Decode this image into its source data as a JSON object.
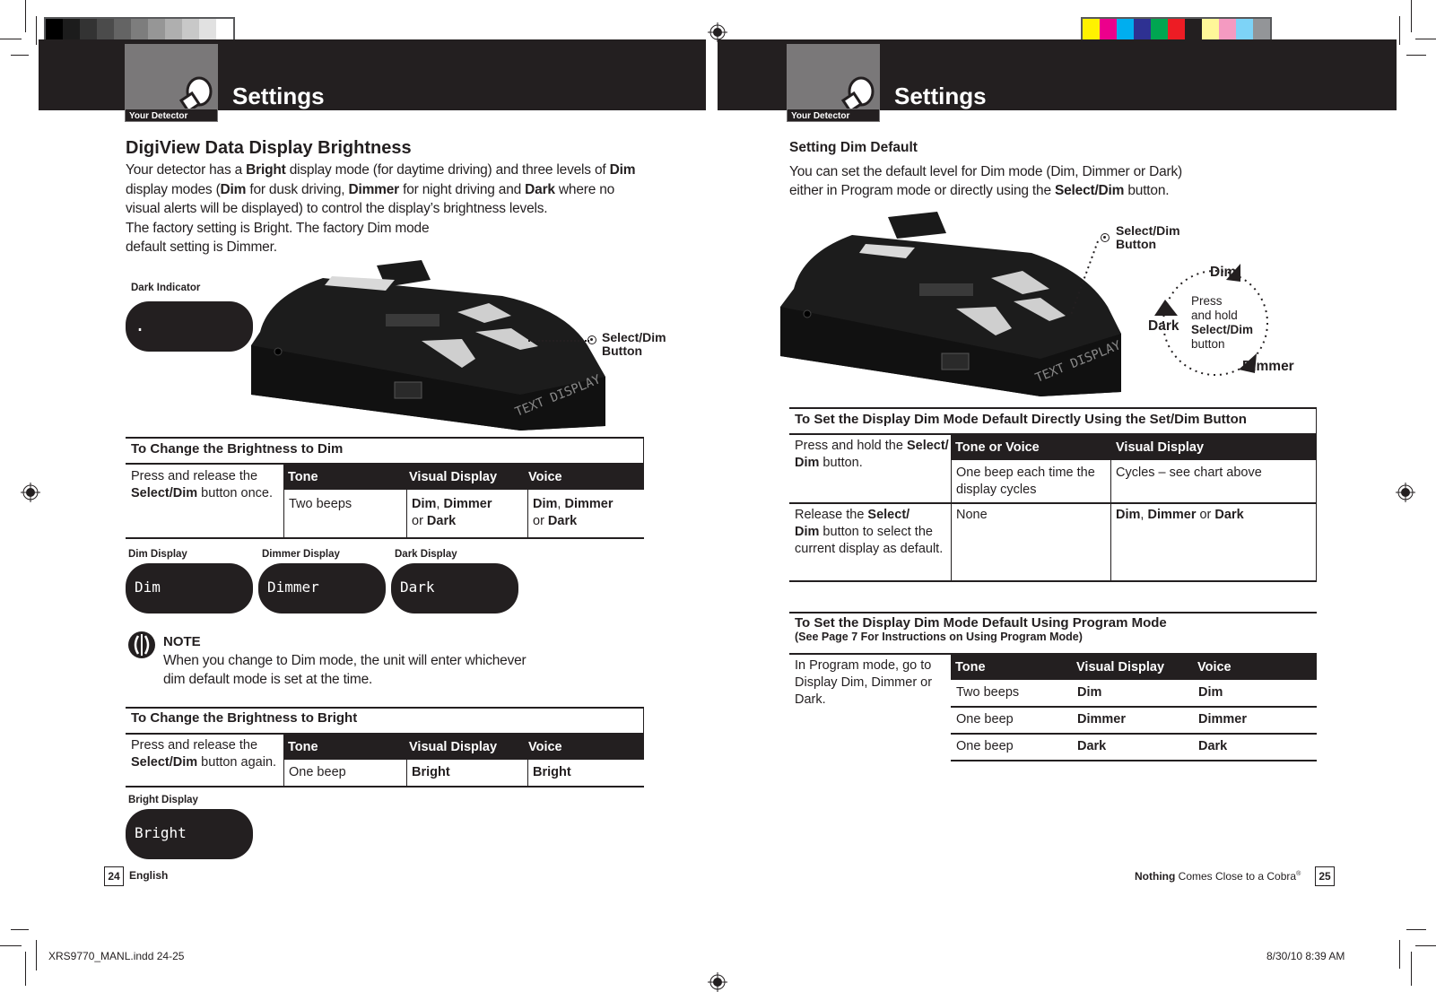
{
  "header": {
    "left": {
      "section_label": "Your Detector",
      "title": "Settings"
    },
    "right": {
      "section_label": "Your Detector",
      "title": "Settings"
    },
    "grayscale_swatches": [
      "#000000",
      "#1c1c1c",
      "#333333",
      "#4b4b4b",
      "#646464",
      "#7d7d7d",
      "#969696",
      "#afafaf",
      "#c8c8c8",
      "#e1e1e1",
      "#ffffff"
    ],
    "color_swatches": [
      "#fff200",
      "#ec008c",
      "#00aeef",
      "#2e3192",
      "#00a651",
      "#ed1c24",
      "#231f20",
      "#fff799",
      "#f49ac1",
      "#7dd3f7",
      "#939598"
    ]
  },
  "left_page": {
    "heading": "DigiView Data Display Brightness",
    "intro": [
      {
        "t": "Your detector has a ",
        "b": false
      },
      {
        "t": "Bright",
        "b": true
      },
      {
        "t": " display mode (for daytime driving) and three levels of ",
        "b": false
      },
      {
        "t": "Dim",
        "b": true
      },
      {
        "t": " display modes (",
        "b": false
      },
      {
        "t": "Dim",
        "b": true
      },
      {
        "t": " for dusk driving, ",
        "b": false
      },
      {
        "t": "Dimmer",
        "b": true
      },
      {
        "t": " for night driving and ",
        "b": false
      },
      {
        "t": "Dark",
        "b": true
      },
      {
        "t": " where no visual alerts will be displayed) to control the display’s brightness levels.",
        "b": false
      }
    ],
    "intro_2": "The factory setting is Bright. The factory Dim mode",
    "intro_3": "default setting is Dimmer.",
    "dark_indicator_label": "Dark Indicator",
    "dark_indicator_value": ".",
    "device_screen_text": "TEXT DISPLAY",
    "callout_line1": "Select/Dim",
    "callout_line2": "Button",
    "dim_table": {
      "title": "To Change the Brightness to Dim",
      "instruction_plain": "Press and release the ",
      "instruction_bold": "Select/Dim",
      "instruction_end": " button once.",
      "headers": [
        "Tone",
        "Visual Display",
        "Voice"
      ],
      "row": {
        "tone": "Two beeps",
        "visual_a": "Dim",
        "visual_b": ", ",
        "visual_c": "Dimmer",
        "visual_or": "or ",
        "visual_d": "Dark",
        "voice_a": "Dim",
        "voice_c": "Dimmer",
        "voice_d": "Dark"
      }
    },
    "displays": [
      {
        "label": "Dim Display",
        "value": "Dim"
      },
      {
        "label": "Dimmer Display",
        "value": "Dimmer"
      },
      {
        "label": "Dark Display",
        "value": "Dark"
      }
    ],
    "note": {
      "title": "NOTE",
      "line1": "When you change to Dim mode, the unit will enter whichever",
      "line2": "dim default mode is set at the time."
    },
    "bright_table": {
      "title": "To Change the Brightness to Bright",
      "instruction_plain": "Press and release the ",
      "instruction_bold": "Select/Dim",
      "instruction_end": " button again.",
      "headers": [
        "Tone",
        "Visual Display",
        "Voice"
      ],
      "row": {
        "tone": "One beep",
        "visual": "Bright",
        "voice": "Bright"
      }
    },
    "bright_display": {
      "label": "Bright Display",
      "value": "Bright"
    },
    "footer": {
      "page_number": "24",
      "language": "English"
    }
  },
  "right_page": {
    "subheading": "Setting Dim Default",
    "intro_line1": "You can set the default level for Dim mode (Dim, Dimmer or Dark)",
    "intro_line2_plain": "either in Program mode or directly using the ",
    "intro_line2_bold": "Select/Dim",
    "intro_line2_end": " button.",
    "device_screen_text": "TEXT DISPLAY",
    "callout_line1": "Select/Dim",
    "callout_line2": "Button",
    "cycle": {
      "dim": "Dim",
      "dimmer": "Dimmer",
      "dark": "Dark",
      "center_1": "Press",
      "center_2": "and hold",
      "center_3": "Select/Dim",
      "center_4": "button"
    },
    "direct_table": {
      "title": "To Set the Display Dim Mode Default Directly Using the Set/Dim Button",
      "headers": [
        "Tone or Voice",
        "Visual Display"
      ],
      "rows": [
        {
          "step_plain": "Press and hold the ",
          "step_bold1": "Select/",
          "step_bold2": "Dim",
          "step_end": " button.",
          "tone": "One beep each time the display cycles",
          "visual": "Cycles – see chart above"
        },
        {
          "step_plain": "Release the ",
          "step_bold1": "Select/",
          "step_bold2": "Dim",
          "step_end": " button to select the current display as default.",
          "tone": "None",
          "visual_a": "Dim",
          "visual_b": "Dimmer",
          "visual_or": " or ",
          "visual_c": "Dark"
        }
      ]
    },
    "program_table": {
      "title": "To Set the Display Dim Mode Default Using Program Mode",
      "subtitle": "(See Page 7 For Instructions on Using Program Mode)",
      "instruction": "In Program mode, go to Display Dim, Dimmer or Dark.",
      "headers": [
        "Tone",
        "Visual Display",
        "Voice"
      ],
      "rows": [
        {
          "tone": "Two beeps",
          "visual": "Dim",
          "voice": "Dim"
        },
        {
          "tone": "One beep",
          "visual": "Dimmer",
          "voice": "Dimmer"
        },
        {
          "tone": "One beep",
          "visual": "Dark",
          "voice": "Dark"
        }
      ]
    },
    "footer": {
      "tagline_bold": "Nothing",
      "tagline_rest": " Comes Close to a Cobra",
      "tagline_reg": "®",
      "page_number": "25"
    }
  },
  "slug": {
    "file": "XRS9770_MANL.indd   24-25",
    "timestamp": "8/30/10   8:39 AM"
  }
}
